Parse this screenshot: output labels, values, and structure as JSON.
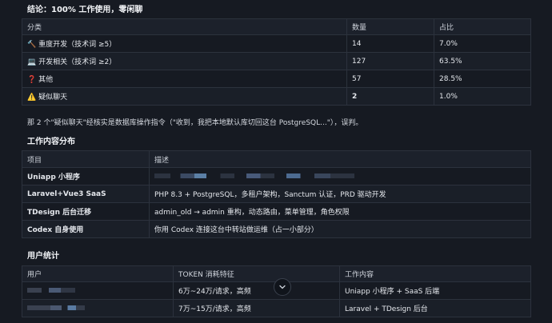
{
  "conclusion": {
    "heading": "结论：100% 工作使用，零闲聊",
    "headers": [
      "分类",
      "数量",
      "占比"
    ],
    "rows": [
      {
        "icon": "hammer-icon",
        "glyph": "🔨",
        "category": "重度开发（技术词 ≥5）",
        "count": "14",
        "share": "7.0%",
        "bold": false
      },
      {
        "icon": "laptop-icon",
        "glyph": "💻",
        "category": "开发相关（技术词 ≥2）",
        "count": "127",
        "share": "63.5%",
        "bold": false
      },
      {
        "icon": "question-icon",
        "glyph": "❓",
        "category": "其他",
        "count": "57",
        "share": "28.5%",
        "bold": false
      },
      {
        "icon": "warning-icon",
        "glyph": "⚠️",
        "category": "疑似聊天",
        "count": "2",
        "share": "1.0%",
        "bold": true
      }
    ],
    "note": "那 2 个\"疑似聊天\"经核实是数据库操作指令（\"收到，我把本地默认库切回这台 PostgreSQL...\"），误判。"
  },
  "distribution": {
    "heading": "工作内容分布",
    "headers": [
      "项目",
      "描述"
    ],
    "rows": [
      {
        "project": "Uniapp 小程序",
        "desc": ""
      },
      {
        "project": "Laravel+Vue3 SaaS",
        "desc": "PHP 8.3 + PostgreSQL，多租户架构，Sanctum 认证，PRD 驱动开发"
      },
      {
        "project": "TDesign 后台迁移",
        "desc": "admin_old → admin 重构，动态路由，菜单管理，角色权限"
      },
      {
        "project": "Codex 自身使用",
        "desc": "你用 Codex 连接这台中转站做运维（占一小部分）"
      }
    ]
  },
  "users": {
    "heading": "用户统计",
    "headers": [
      "用户",
      "TOKEN 消耗特征",
      "工作内容"
    ],
    "rows": [
      {
        "user": "",
        "token": "6万~24万/请求，高频",
        "work": "Uniapp 小程序 + SaaS 后端"
      },
      {
        "user": "",
        "token": "7万~15万/请求，高频",
        "work": "Laravel + TDesign 后台"
      }
    ]
  },
  "colors": {
    "background": "#161a22",
    "header_bg": "#1c212b",
    "border": "#2c323d",
    "text": "#e4e7ec"
  }
}
